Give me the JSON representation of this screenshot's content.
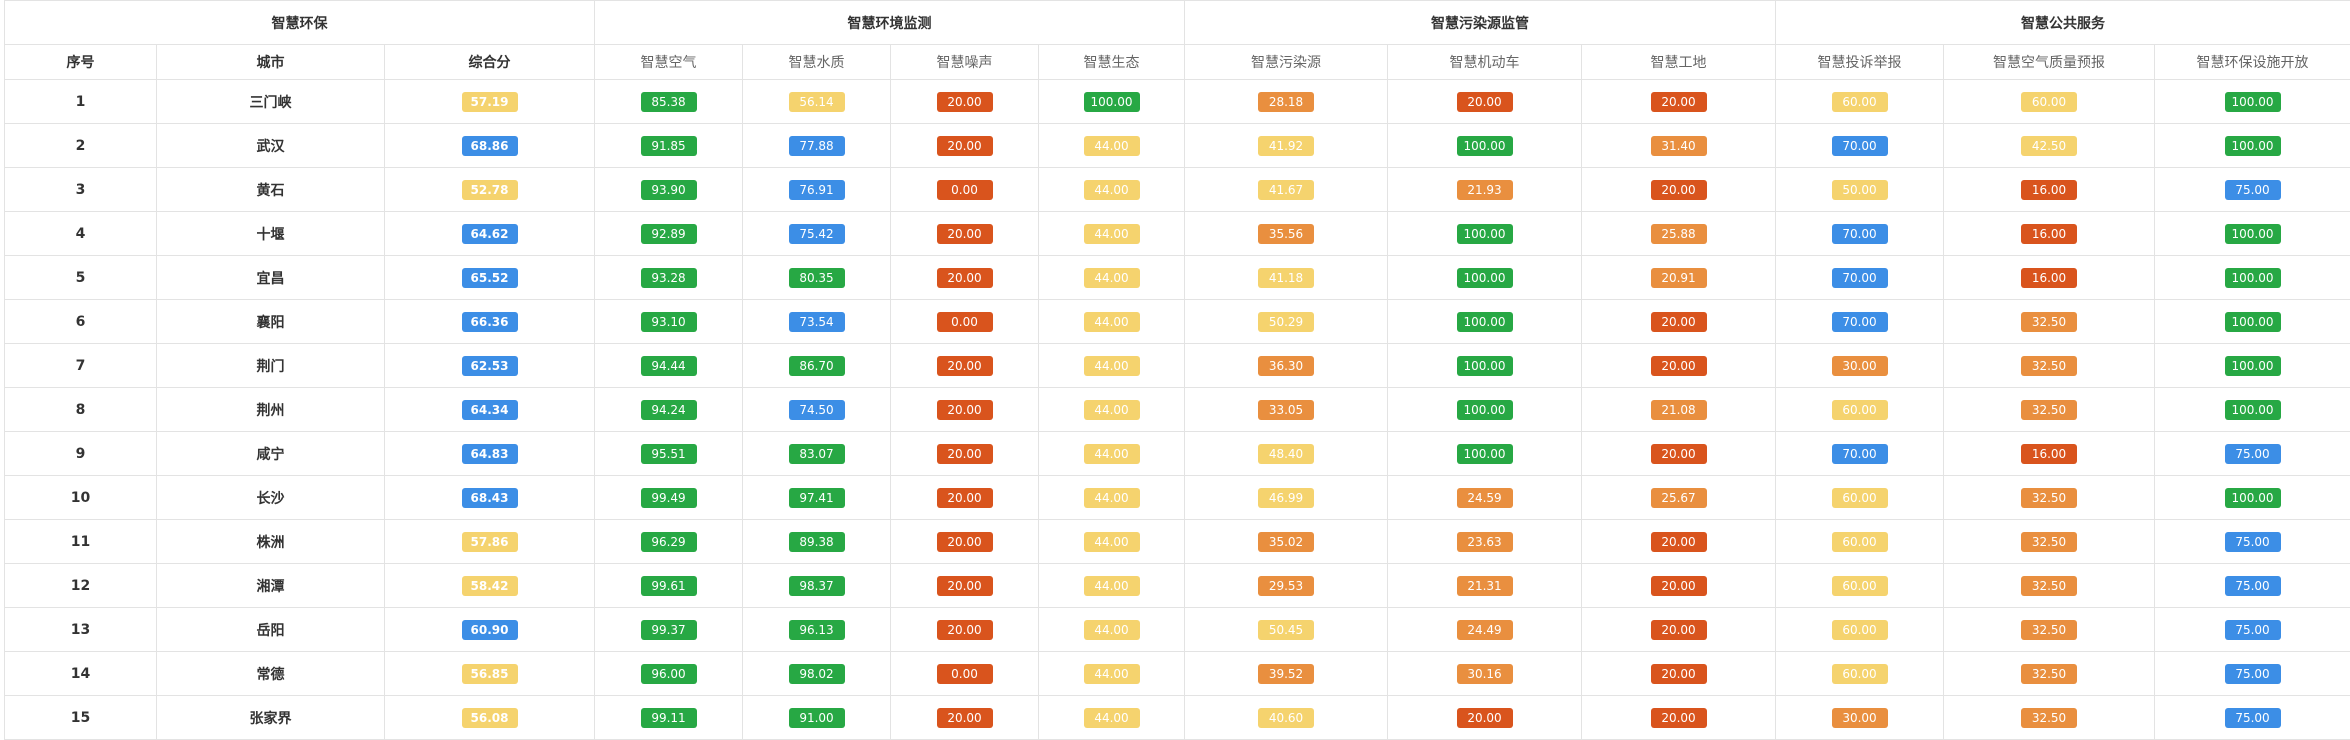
{
  "groups": [
    "智慧环保",
    "智慧环境监测",
    "智慧污染源监管",
    "智慧公共服务"
  ],
  "columns": [
    "序号",
    "城市",
    "综合分",
    "智慧空气",
    "智慧水质",
    "智慧噪声",
    "智慧生态",
    "智慧污染源",
    "智慧机动车",
    "智慧工地",
    "智慧投诉举报",
    "智慧空气质量预报",
    "智慧环保设施开放"
  ],
  "colors": {
    "green": "#27a844",
    "blue": "#3c8ee6",
    "yellow": "#f5d36e",
    "orange": "#e98f3f",
    "red": "#d9541d"
  },
  "rows": [
    {
      "idx": "1",
      "city": "三门峡",
      "scores": [
        [
          "57.19",
          "yellow"
        ],
        [
          "85.38",
          "green"
        ],
        [
          "56.14",
          "yellow"
        ],
        [
          "20.00",
          "red"
        ],
        [
          "100.00",
          "green"
        ],
        [
          "28.18",
          "orange"
        ],
        [
          "20.00",
          "red"
        ],
        [
          "20.00",
          "red"
        ],
        [
          "60.00",
          "yellow"
        ],
        [
          "60.00",
          "yellow"
        ],
        [
          "100.00",
          "green"
        ]
      ]
    },
    {
      "idx": "2",
      "city": "武汉",
      "scores": [
        [
          "68.86",
          "blue"
        ],
        [
          "91.85",
          "green"
        ],
        [
          "77.88",
          "blue"
        ],
        [
          "20.00",
          "red"
        ],
        [
          "44.00",
          "yellow"
        ],
        [
          "41.92",
          "yellow"
        ],
        [
          "100.00",
          "green"
        ],
        [
          "31.40",
          "orange"
        ],
        [
          "70.00",
          "blue"
        ],
        [
          "42.50",
          "yellow"
        ],
        [
          "100.00",
          "green"
        ]
      ]
    },
    {
      "idx": "3",
      "city": "黄石",
      "scores": [
        [
          "52.78",
          "yellow"
        ],
        [
          "93.90",
          "green"
        ],
        [
          "76.91",
          "blue"
        ],
        [
          "0.00",
          "red"
        ],
        [
          "44.00",
          "yellow"
        ],
        [
          "41.67",
          "yellow"
        ],
        [
          "21.93",
          "orange"
        ],
        [
          "20.00",
          "red"
        ],
        [
          "50.00",
          "yellow"
        ],
        [
          "16.00",
          "red"
        ],
        [
          "75.00",
          "blue"
        ]
      ]
    },
    {
      "idx": "4",
      "city": "十堰",
      "scores": [
        [
          "64.62",
          "blue"
        ],
        [
          "92.89",
          "green"
        ],
        [
          "75.42",
          "blue"
        ],
        [
          "20.00",
          "red"
        ],
        [
          "44.00",
          "yellow"
        ],
        [
          "35.56",
          "orange"
        ],
        [
          "100.00",
          "green"
        ],
        [
          "25.88",
          "orange"
        ],
        [
          "70.00",
          "blue"
        ],
        [
          "16.00",
          "red"
        ],
        [
          "100.00",
          "green"
        ]
      ]
    },
    {
      "idx": "5",
      "city": "宜昌",
      "scores": [
        [
          "65.52",
          "blue"
        ],
        [
          "93.28",
          "green"
        ],
        [
          "80.35",
          "green"
        ],
        [
          "20.00",
          "red"
        ],
        [
          "44.00",
          "yellow"
        ],
        [
          "41.18",
          "yellow"
        ],
        [
          "100.00",
          "green"
        ],
        [
          "20.91",
          "orange"
        ],
        [
          "70.00",
          "blue"
        ],
        [
          "16.00",
          "red"
        ],
        [
          "100.00",
          "green"
        ]
      ]
    },
    {
      "idx": "6",
      "city": "襄阳",
      "scores": [
        [
          "66.36",
          "blue"
        ],
        [
          "93.10",
          "green"
        ],
        [
          "73.54",
          "blue"
        ],
        [
          "0.00",
          "red"
        ],
        [
          "44.00",
          "yellow"
        ],
        [
          "50.29",
          "yellow"
        ],
        [
          "100.00",
          "green"
        ],
        [
          "20.00",
          "red"
        ],
        [
          "70.00",
          "blue"
        ],
        [
          "32.50",
          "orange"
        ],
        [
          "100.00",
          "green"
        ]
      ]
    },
    {
      "idx": "7",
      "city": "荆门",
      "scores": [
        [
          "62.53",
          "blue"
        ],
        [
          "94.44",
          "green"
        ],
        [
          "86.70",
          "green"
        ],
        [
          "20.00",
          "red"
        ],
        [
          "44.00",
          "yellow"
        ],
        [
          "36.30",
          "orange"
        ],
        [
          "100.00",
          "green"
        ],
        [
          "20.00",
          "red"
        ],
        [
          "30.00",
          "orange"
        ],
        [
          "32.50",
          "orange"
        ],
        [
          "100.00",
          "green"
        ]
      ]
    },
    {
      "idx": "8",
      "city": "荆州",
      "scores": [
        [
          "64.34",
          "blue"
        ],
        [
          "94.24",
          "green"
        ],
        [
          "74.50",
          "blue"
        ],
        [
          "20.00",
          "red"
        ],
        [
          "44.00",
          "yellow"
        ],
        [
          "33.05",
          "orange"
        ],
        [
          "100.00",
          "green"
        ],
        [
          "21.08",
          "orange"
        ],
        [
          "60.00",
          "yellow"
        ],
        [
          "32.50",
          "orange"
        ],
        [
          "100.00",
          "green"
        ]
      ]
    },
    {
      "idx": "9",
      "city": "咸宁",
      "scores": [
        [
          "64.83",
          "blue"
        ],
        [
          "95.51",
          "green"
        ],
        [
          "83.07",
          "green"
        ],
        [
          "20.00",
          "red"
        ],
        [
          "44.00",
          "yellow"
        ],
        [
          "48.40",
          "yellow"
        ],
        [
          "100.00",
          "green"
        ],
        [
          "20.00",
          "red"
        ],
        [
          "70.00",
          "blue"
        ],
        [
          "16.00",
          "red"
        ],
        [
          "75.00",
          "blue"
        ]
      ]
    },
    {
      "idx": "10",
      "city": "长沙",
      "scores": [
        [
          "68.43",
          "blue"
        ],
        [
          "99.49",
          "green"
        ],
        [
          "97.41",
          "green"
        ],
        [
          "20.00",
          "red"
        ],
        [
          "44.00",
          "yellow"
        ],
        [
          "46.99",
          "yellow"
        ],
        [
          "24.59",
          "orange"
        ],
        [
          "25.67",
          "orange"
        ],
        [
          "60.00",
          "yellow"
        ],
        [
          "32.50",
          "orange"
        ],
        [
          "100.00",
          "green"
        ]
      ]
    },
    {
      "idx": "11",
      "city": "株洲",
      "scores": [
        [
          "57.86",
          "yellow"
        ],
        [
          "96.29",
          "green"
        ],
        [
          "89.38",
          "green"
        ],
        [
          "20.00",
          "red"
        ],
        [
          "44.00",
          "yellow"
        ],
        [
          "35.02",
          "orange"
        ],
        [
          "23.63",
          "orange"
        ],
        [
          "20.00",
          "red"
        ],
        [
          "60.00",
          "yellow"
        ],
        [
          "32.50",
          "orange"
        ],
        [
          "75.00",
          "blue"
        ]
      ]
    },
    {
      "idx": "12",
      "city": "湘潭",
      "scores": [
        [
          "58.42",
          "yellow"
        ],
        [
          "99.61",
          "green"
        ],
        [
          "98.37",
          "green"
        ],
        [
          "20.00",
          "red"
        ],
        [
          "44.00",
          "yellow"
        ],
        [
          "29.53",
          "orange"
        ],
        [
          "21.31",
          "orange"
        ],
        [
          "20.00",
          "red"
        ],
        [
          "60.00",
          "yellow"
        ],
        [
          "32.50",
          "orange"
        ],
        [
          "75.00",
          "blue"
        ]
      ]
    },
    {
      "idx": "13",
      "city": "岳阳",
      "scores": [
        [
          "60.90",
          "blue"
        ],
        [
          "99.37",
          "green"
        ],
        [
          "96.13",
          "green"
        ],
        [
          "20.00",
          "red"
        ],
        [
          "44.00",
          "yellow"
        ],
        [
          "50.45",
          "yellow"
        ],
        [
          "24.49",
          "orange"
        ],
        [
          "20.00",
          "red"
        ],
        [
          "60.00",
          "yellow"
        ],
        [
          "32.50",
          "orange"
        ],
        [
          "75.00",
          "blue"
        ]
      ]
    },
    {
      "idx": "14",
      "city": "常德",
      "scores": [
        [
          "56.85",
          "yellow"
        ],
        [
          "96.00",
          "green"
        ],
        [
          "98.02",
          "green"
        ],
        [
          "0.00",
          "red"
        ],
        [
          "44.00",
          "yellow"
        ],
        [
          "39.52",
          "orange"
        ],
        [
          "30.16",
          "orange"
        ],
        [
          "20.00",
          "red"
        ],
        [
          "60.00",
          "yellow"
        ],
        [
          "32.50",
          "orange"
        ],
        [
          "75.00",
          "blue"
        ]
      ]
    },
    {
      "idx": "15",
      "city": "张家界",
      "scores": [
        [
          "56.08",
          "yellow"
        ],
        [
          "99.11",
          "green"
        ],
        [
          "91.00",
          "green"
        ],
        [
          "20.00",
          "red"
        ],
        [
          "44.00",
          "yellow"
        ],
        [
          "40.60",
          "yellow"
        ],
        [
          "20.00",
          "red"
        ],
        [
          "20.00",
          "red"
        ],
        [
          "30.00",
          "orange"
        ],
        [
          "32.50",
          "orange"
        ],
        [
          "75.00",
          "blue"
        ]
      ]
    }
  ]
}
